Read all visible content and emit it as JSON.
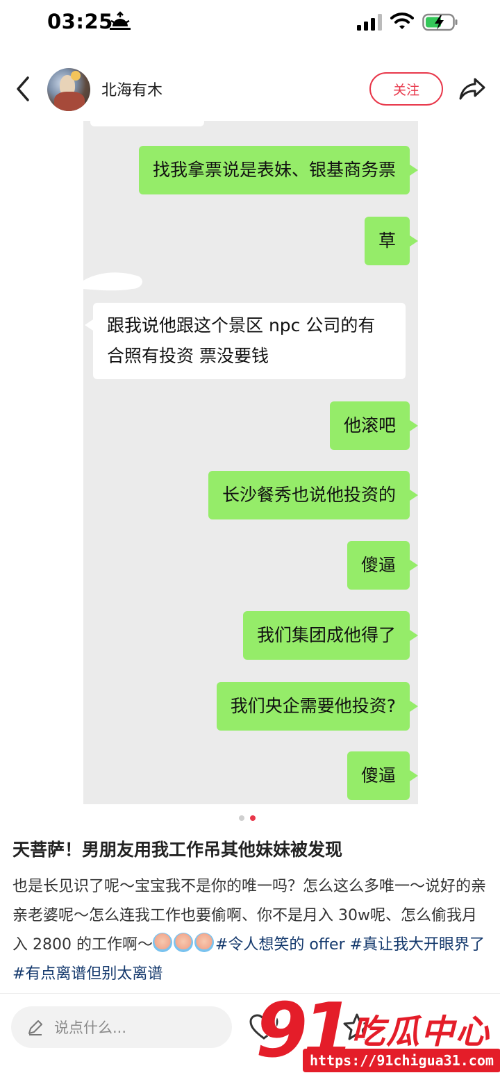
{
  "status_bar": {
    "time": "03:25"
  },
  "header": {
    "username": "北海有木",
    "follow_label": "关注"
  },
  "chat": {
    "messages": [
      {
        "side": "right",
        "text": "找我拿票说是表妹、银基商务票"
      },
      {
        "side": "right",
        "text": "草"
      },
      {
        "side": "left",
        "text": "跟我说他跟这个景区 npc 公司的有合照有投资 票没要钱"
      },
      {
        "side": "right",
        "text": "他滚吧"
      },
      {
        "side": "right",
        "text": "长沙餐秀也说他投资的"
      },
      {
        "side": "right",
        "text": "傻逼"
      },
      {
        "side": "right",
        "text": "我们集团成他得了"
      },
      {
        "side": "right",
        "text": "我们央企需要他投资?"
      },
      {
        "side": "right",
        "text": "傻逼"
      }
    ]
  },
  "carousel": {
    "total": 2,
    "active_index": 2
  },
  "post": {
    "title": "天菩萨！男朋友用我工作吊其他妹妹被发现",
    "body": "也是长见识了呢～宝宝我不是你的唯一吗？怎么这么多唯一～说好的亲亲老婆呢～怎么连我工作也要偷啊、你不是月入 30w呢、怎么偷我月入 2800 的工作啊～",
    "tags": [
      "#令人想笑的 offer",
      "#真让我大开眼界了",
      "#有点离谱但别太离谱"
    ]
  },
  "bottom_bar": {
    "comment_placeholder": "说点什么..."
  },
  "watermark": {
    "number": "91",
    "brand": "吃瓜中心",
    "url": "https://91chigua31.com"
  },
  "colors": {
    "accent": "#e8374a",
    "bubble_me": "#95ec69",
    "bubble_other": "#ffffff",
    "chat_bg": "#ebebeb",
    "tag": "#13386c",
    "watermark": "#e41d29"
  }
}
